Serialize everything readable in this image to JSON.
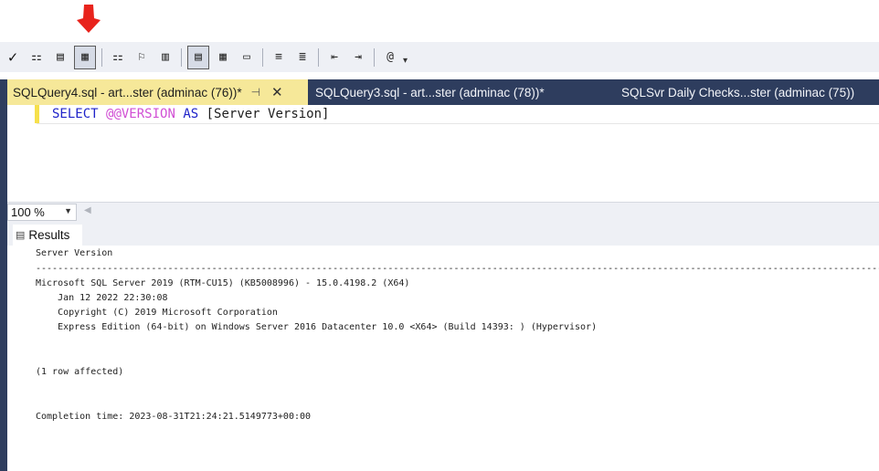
{
  "annotation": {
    "arrow_color": "#e8231c"
  },
  "toolbar": {
    "buttons": [
      "check-icon",
      "estimated-plan-icon",
      "results-to-text-icon",
      "results-to-grid-icon",
      "query-options-icon",
      "include-plan-icon",
      "client-stats-icon",
      "results-as-text-icon",
      "results-grid-icon",
      "results-file-icon",
      "comment-icon",
      "uncomment-icon",
      "decrease-indent-icon",
      "increase-indent-icon",
      "specify-values-icon"
    ]
  },
  "tabs": [
    {
      "label": "SQLQuery4.sql - art...ster (adminac (76))*",
      "active": true
    },
    {
      "label": "SQLQuery3.sql - art...ster (adminac (78))*",
      "active": false
    },
    {
      "label": "SQLSvr Daily Checks...ster (adminac (75))",
      "active": false
    }
  ],
  "editor": {
    "code_parts": {
      "select": "SELECT",
      "sysfn": "@@VERSION",
      "as": "AS",
      "rest": "[Server Version]"
    }
  },
  "zoom": {
    "value": "100 %"
  },
  "results": {
    "tab_label": "Results",
    "lines": [
      "Server Version",
      "--------------------------------------------------------------------------------------------------------------------------------------------------------------------------------------------------------------------",
      "Microsoft SQL Server 2019 (RTM-CU15) (KB5008996) - 15.0.4198.2 (X64)",
      "    Jan 12 2022 22:30:08",
      "    Copyright (C) 2019 Microsoft Corporation",
      "    Express Edition (64-bit) on Windows Server 2016 Datacenter 10.0 <X64> (Build 14393: ) (Hypervisor)",
      "(1 row affected)",
      "Completion time: 2023-08-31T21:24:21.5149773+00:00"
    ]
  },
  "colors": {
    "tab_strip": "#2e3d5e",
    "active_tab": "#f6e899",
    "keyword": "#1f23c9",
    "system_function": "#d14fd4"
  }
}
